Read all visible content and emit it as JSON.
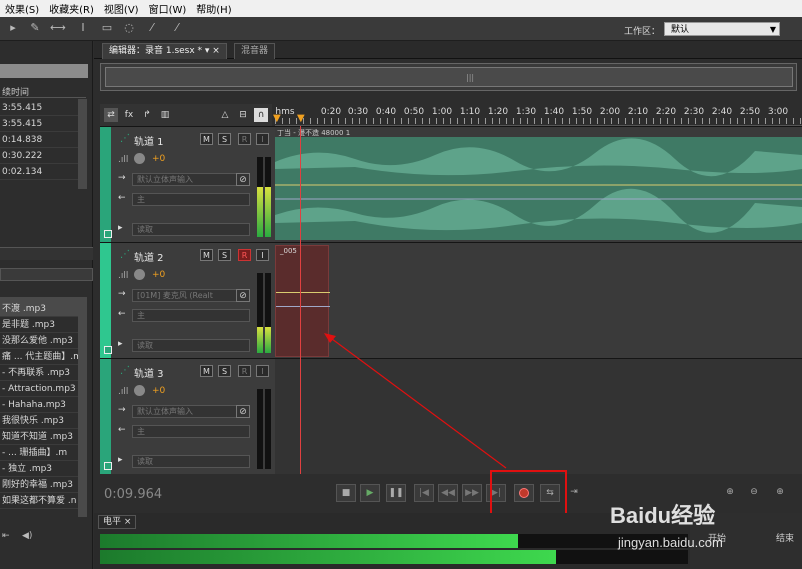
{
  "menu": [
    "效果(S)",
    "收藏夹(R)",
    "视图(V)",
    "窗口(W)",
    "帮助(H)"
  ],
  "workspace": {
    "label": "工作区：",
    "value": "默认"
  },
  "files_panel": {
    "header": "续时间",
    "durations": [
      "3:55.415",
      "3:55.415",
      "0:14.838",
      "0:30.222",
      "0:02.134"
    ]
  },
  "media_list": [
    "不渡 .mp3",
    "是非题 .mp3",
    "没那么爱他 .mp3",
    "痛 ... 代主题曲】.m",
    "- 不再联系 .mp3",
    "- Attraction.mp3",
    "- Hahaha.mp3",
    "我很快乐 .mp3",
    "知道不知道 .mp3",
    "- ... 珊插曲】.m",
    "- 独立 .mp3",
    "刚好的幸福 .mp3",
    "如果这都不算爱 .n"
  ],
  "tabs": {
    "editor": "编辑器：录音 1.sesx *",
    "mixer": "混音器"
  },
  "ruler_labels": [
    "hms",
    "0:20",
    "0:30",
    "0:40",
    "0:50",
    "1:00",
    "1:10",
    "1:20",
    "1:30",
    "1:40",
    "1:50",
    "2:00",
    "2:10",
    "2:20",
    "2:30",
    "2:40",
    "2:50",
    "3:00"
  ],
  "tracks": [
    {
      "name": "轨道 1",
      "volume": "+0",
      "input": "默认立体声输入",
      "output": "主",
      "read": "读取",
      "clip": "丁当 - 漫不造 48000 1"
    },
    {
      "name": "轨道 2",
      "volume": "+0",
      "input": "[01M] 麦克风 (Realt",
      "output": "主",
      "read": "读取",
      "clip": "_005"
    },
    {
      "name": "轨道 3",
      "volume": "+0",
      "input": "默认立体声输入",
      "output": "主",
      "read": "读取",
      "clip": ""
    }
  ],
  "track_buttons": [
    "M",
    "S",
    "R",
    "I"
  ],
  "timecode": "0:09.964",
  "level_tab": "电平",
  "props": {
    "start_label": "开始",
    "end_label": "结束"
  },
  "watermark": {
    "brand": "Baidu经验",
    "url": "jingyan.baidu.com"
  },
  "colors": {
    "waveform": "#3f7a65",
    "track_accent": "#2aa57a",
    "record": "#c0392b",
    "callout": "#e01010",
    "playhead": "#e04040"
  }
}
